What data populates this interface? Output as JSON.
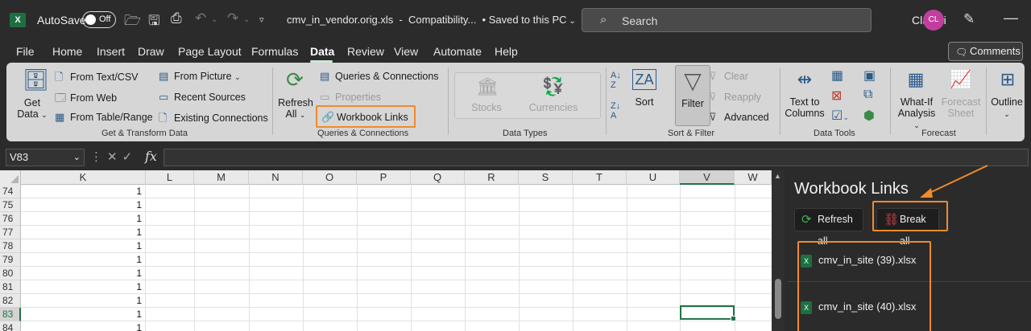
{
  "titlebar": {
    "app_logo": "X",
    "autosave_label": "AutoSave",
    "autosave_state": "Off",
    "filename": "cmv_in_vendor.orig.xls",
    "mode": "Compatibility...",
    "saved_status": "• Saved to this PC",
    "search_placeholder": "Search",
    "user_name": "Clay Li",
    "user_initials": "CL"
  },
  "tabs": [
    "File",
    "Home",
    "Insert",
    "Draw",
    "Page Layout",
    "Formulas",
    "Data",
    "Review",
    "View",
    "Automate",
    "Help"
  ],
  "active_tab": "Data",
  "comments_label": "Comments",
  "ribbon": {
    "get_data_1": "Get",
    "get_data_2": "Data",
    "from_text_csv": "From Text/CSV",
    "from_web": "From Web",
    "from_table_range": "From Table/Range",
    "from_picture": "From Picture",
    "recent_sources": "Recent Sources",
    "existing_connections": "Existing Connections",
    "group_get_transform": "Get & Transform Data",
    "refresh_all_1": "Refresh",
    "refresh_all_2": "All",
    "queries_connections": "Queries & Connections",
    "properties": "Properties",
    "workbook_links": "Workbook Links",
    "group_queries": "Queries & Connections",
    "stocks": "Stocks",
    "currencies": "Currencies",
    "group_data_types": "Data Types",
    "sort": "Sort",
    "filter": "Filter",
    "clear": "Clear",
    "reapply": "Reapply",
    "advanced": "Advanced",
    "group_sort_filter": "Sort & Filter",
    "text_to_columns_1": "Text to",
    "text_to_columns_2": "Columns",
    "group_data_tools": "Data Tools",
    "what_if_1": "What-If",
    "what_if_2": "Analysis",
    "forecast_sheet_1": "Forecast",
    "forecast_sheet_2": "Sheet",
    "group_forecast": "Forecast",
    "outline": "Outline"
  },
  "formula_bar": {
    "name_box": "V83",
    "fx": "fx",
    "formula": ""
  },
  "grid": {
    "columns": [
      "K",
      "L",
      "M",
      "N",
      "O",
      "P",
      "Q",
      "R",
      "S",
      "T",
      "U",
      "V",
      "W"
    ],
    "selected_column": "V",
    "rows": [
      {
        "num": "74",
        "k": "1"
      },
      {
        "num": "75",
        "k": "1"
      },
      {
        "num": "76",
        "k": "1"
      },
      {
        "num": "77",
        "k": "1"
      },
      {
        "num": "78",
        "k": "1"
      },
      {
        "num": "79",
        "k": "1"
      },
      {
        "num": "80",
        "k": "1"
      },
      {
        "num": "81",
        "k": "1"
      },
      {
        "num": "82",
        "k": "1"
      },
      {
        "num": "83",
        "k": "1"
      },
      {
        "num": "84",
        "k": "1"
      }
    ],
    "selected_row": "83"
  },
  "pane": {
    "title": "Workbook Links",
    "refresh_all": "Refresh all",
    "break_all": "Break all",
    "links": [
      "cmv_in_site (39).xlsx",
      "cmv_in_site (40).xlsx"
    ]
  },
  "colors": {
    "highlight": "#f08a2c",
    "excel_green": "#217346"
  }
}
